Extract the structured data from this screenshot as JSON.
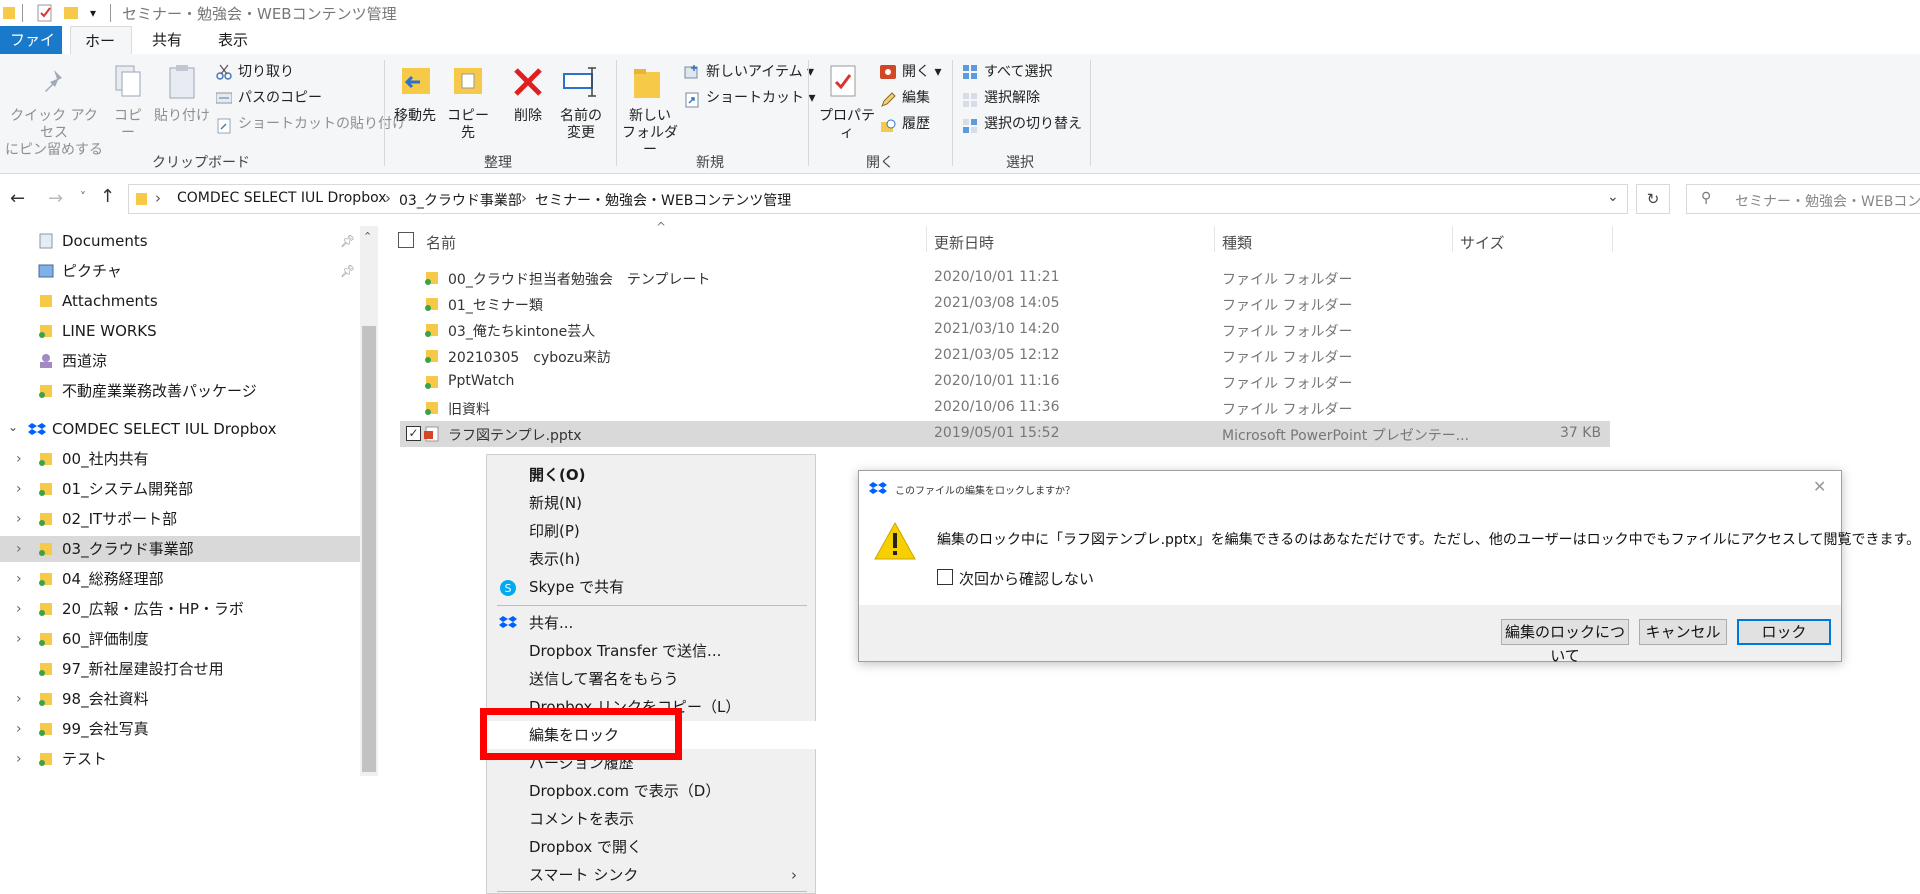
{
  "window": {
    "title": "セミナー・勉強会・WEBコンテンツ管理"
  },
  "tabs": {
    "file": "ファイル",
    "home": "ホーム",
    "share": "共有",
    "view": "表示"
  },
  "ribbon": {
    "clipboard": {
      "pin": [
        "クイック アクセス",
        "にピン留めする"
      ],
      "copy": "コピー",
      "paste": "貼り付け",
      "cut": "切り取り",
      "copy_path": "パスのコピー",
      "paste_shortcut": "ショートカットの貼り付け",
      "group": "クリップボード"
    },
    "organize": {
      "move_to": "移動先",
      "copy_to": "コピー先",
      "delete": "削除",
      "rename": [
        "名前の",
        "変更"
      ],
      "group": "整理"
    },
    "new": {
      "new_folder": [
        "新しい",
        "フォルダー"
      ],
      "new_item": "新しいアイテム",
      "shortcut": "ショートカット",
      "group": "新規"
    },
    "open": {
      "properties": "プロパティ",
      "open": "開く",
      "edit": "編集",
      "history": "履歴",
      "group": "開く"
    },
    "select": {
      "select_all": "すべて選択",
      "select_none": "選択解除",
      "invert": "選択の切り替え",
      "group": "選択"
    }
  },
  "address": {
    "crumbs": [
      "COMDEC SELECT IUL Dropbox",
      "03_クラウド事業部",
      "セミナー・勉強会・WEBコンテンツ管理"
    ],
    "search_placeholder": "セミナー・勉強会・WEBコンテンツ"
  },
  "nav": {
    "quick": [
      "Documents",
      "ピクチャ",
      "Attachments",
      "LINE WORKS",
      "西道涼",
      "不動産業業務改善パッケージ"
    ],
    "root": "COMDEC SELECT IUL Dropbox",
    "folders": [
      "00_社内共有",
      "01_システム開発部",
      "02_ITサポート部",
      "03_クラウド事業部",
      "04_総務経理部",
      "20_広報・広告・HP・ラボ",
      "60_評価制度",
      "97_新社屋建設打合せ用",
      "98_会社資料",
      "99_会社写真",
      "テスト"
    ]
  },
  "columns": {
    "name": "名前",
    "date": "更新日時",
    "type": "種類",
    "size": "サイズ"
  },
  "files": [
    {
      "name": "00_クラウド担当者勉強会　テンプレート",
      "date": "2020/10/01 11:21",
      "type": "ファイル フォルダー",
      "size": ""
    },
    {
      "name": "01_セミナー類",
      "date": "2021/03/08 14:05",
      "type": "ファイル フォルダー",
      "size": ""
    },
    {
      "name": "03_俺たちkintone芸人",
      "date": "2021/03/10 14:20",
      "type": "ファイル フォルダー",
      "size": ""
    },
    {
      "name": "20210305　cybozu来訪",
      "date": "2021/03/05 12:12",
      "type": "ファイル フォルダー",
      "size": ""
    },
    {
      "name": "PptWatch",
      "date": "2020/10/01 11:16",
      "type": "ファイル フォルダー",
      "size": ""
    },
    {
      "name": "旧資料",
      "date": "2020/10/06 11:36",
      "type": "ファイル フォルダー",
      "size": ""
    },
    {
      "name": "ラフ図テンプレ.pptx",
      "date": "2019/05/01 15:52",
      "type": "Microsoft PowerPoint プレゼンテー...",
      "size": "37 KB"
    }
  ],
  "context_menu": {
    "open": "開く(O)",
    "new": "新規(N)",
    "print": "印刷(P)",
    "show": "表示(h)",
    "skype": "Skype で共有",
    "share": "共有...",
    "transfer": "Dropbox Transfer で送信...",
    "sign": "送信して署名をもらう",
    "copy_link": "Dropbox リンクをコピー（L）",
    "lock": "編集をロック",
    "version": "バージョン履歴",
    "view_web": "Dropbox.com で表示（D）",
    "comments": "コメントを表示",
    "open_dropbox": "Dropbox で開く",
    "smart_sync": "スマート シンク"
  },
  "dialog": {
    "title": "このファイルの編集をロックしますか？",
    "message": "編集のロック中に「ラフ図テンプレ.pptx」を編集できるのはあなただけです。ただし、他のユーザーはロック中でもファイルにアクセスして閲覧できます。",
    "checkbox": "次回から確認しない",
    "about_button": "編集のロックについて",
    "cancel_button": "キャンセル",
    "lock_button": "ロック"
  },
  "colors": {
    "accent": "#1979ca",
    "highlight": "#ff0000",
    "selection": "#d9d9d9",
    "folder": "#f7c948"
  }
}
